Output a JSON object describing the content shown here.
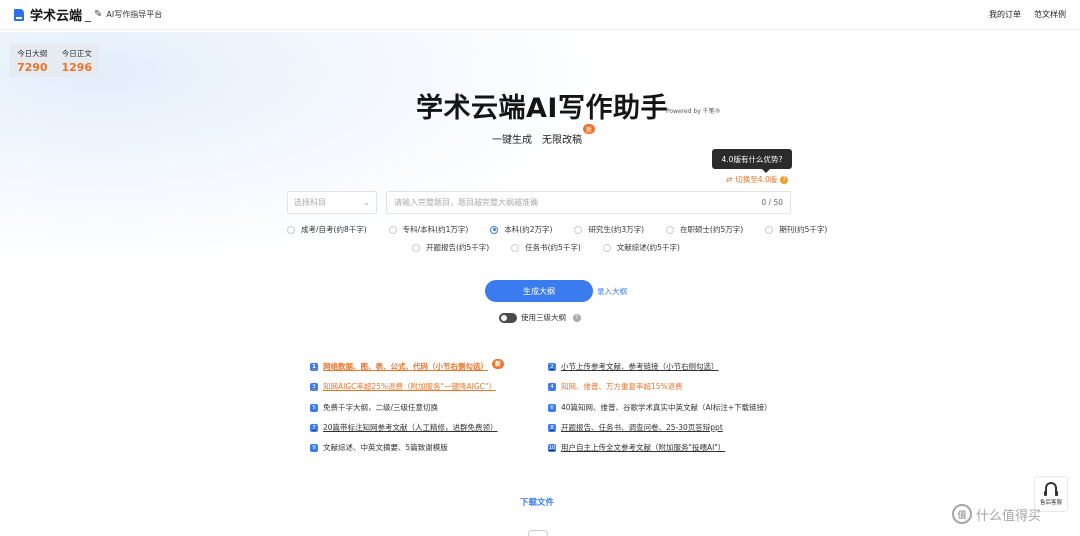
{
  "header": {
    "logo_text": "学术云端",
    "logo_sep": "_",
    "subtitle": "AI写作指导平台",
    "links": [
      "我的订单",
      "范文样例"
    ]
  },
  "stats": [
    {
      "label": "今日大纲",
      "value": "7290"
    },
    {
      "label": "今日正文",
      "value": "1296"
    }
  ],
  "hero": {
    "title": "学术云端AI写作助手",
    "powered": "Powered by 千笔®",
    "slogan_1": "一键生成",
    "slogan_2": "无限改稿",
    "new_badge": "新"
  },
  "version": {
    "tooltip": "4.0版有什么优势?",
    "switch_label": "切换至4.0版",
    "help": "?"
  },
  "form": {
    "subject_placeholder": "选择科目",
    "title_placeholder": "请输入完整题目，题目越完整大纲越准确",
    "char_count": "0 / 50",
    "levels_row1": [
      "成考/自考(约8千字)",
      "专科/本科(约1万字)",
      "本科(约2万字)",
      "研究生(约3万字)",
      "在职硕士(约5万字)",
      "期刊(约5千字)"
    ],
    "levels_row2": [
      "开题报告(约5千字)",
      "任务书(约5千字)",
      "文献综述(约5千字)"
    ],
    "selected_level": "本科(约2万字)",
    "generate_label": "生成大纲",
    "manual_outline_label": "录入大纲",
    "three_level_label": "使用三级大纲",
    "help": "?"
  },
  "features": {
    "left": [
      {
        "n": "1",
        "text": "网络数据、图、表、公式、代码（小节右侧勾选）"
      },
      {
        "n": "3",
        "text": "知网AIGC率超25%退费（附加服务\"一键降AIGC\"）"
      },
      {
        "n": "5",
        "text": "免费千字大纲，二级/三级任意切换"
      },
      {
        "n": "7",
        "text": "20篇带标注知网参考文献（人工精修，进群免费领）"
      },
      {
        "n": "9",
        "text": "文献综述、中英文摘要、5篇致谢模版"
      }
    ],
    "right": [
      {
        "n": "2",
        "text": "小节上传参考文献、参考链接（小节右侧勾选）"
      },
      {
        "n": "4",
        "text": "知网、维普、万方重复率超15%退费"
      },
      {
        "n": "6",
        "text": "40篇知网、维普、谷歌学术真实中英文献（AI标注+下载链接）"
      },
      {
        "n": "8",
        "text": "开题报告、任务书、调查问卷、25-30页答辩ppt"
      },
      {
        "n": "10",
        "text": "用户自主上传全文参考文献（附加服务\"投喂AI\"）"
      }
    ],
    "new_badge": "新"
  },
  "download_label": "下载文件",
  "support_label": "售后客服",
  "watermark": {
    "logo": "值",
    "text": "什么值得买"
  },
  "colors": {
    "accent": "#3a7bf0",
    "orange": "#e8762c"
  }
}
